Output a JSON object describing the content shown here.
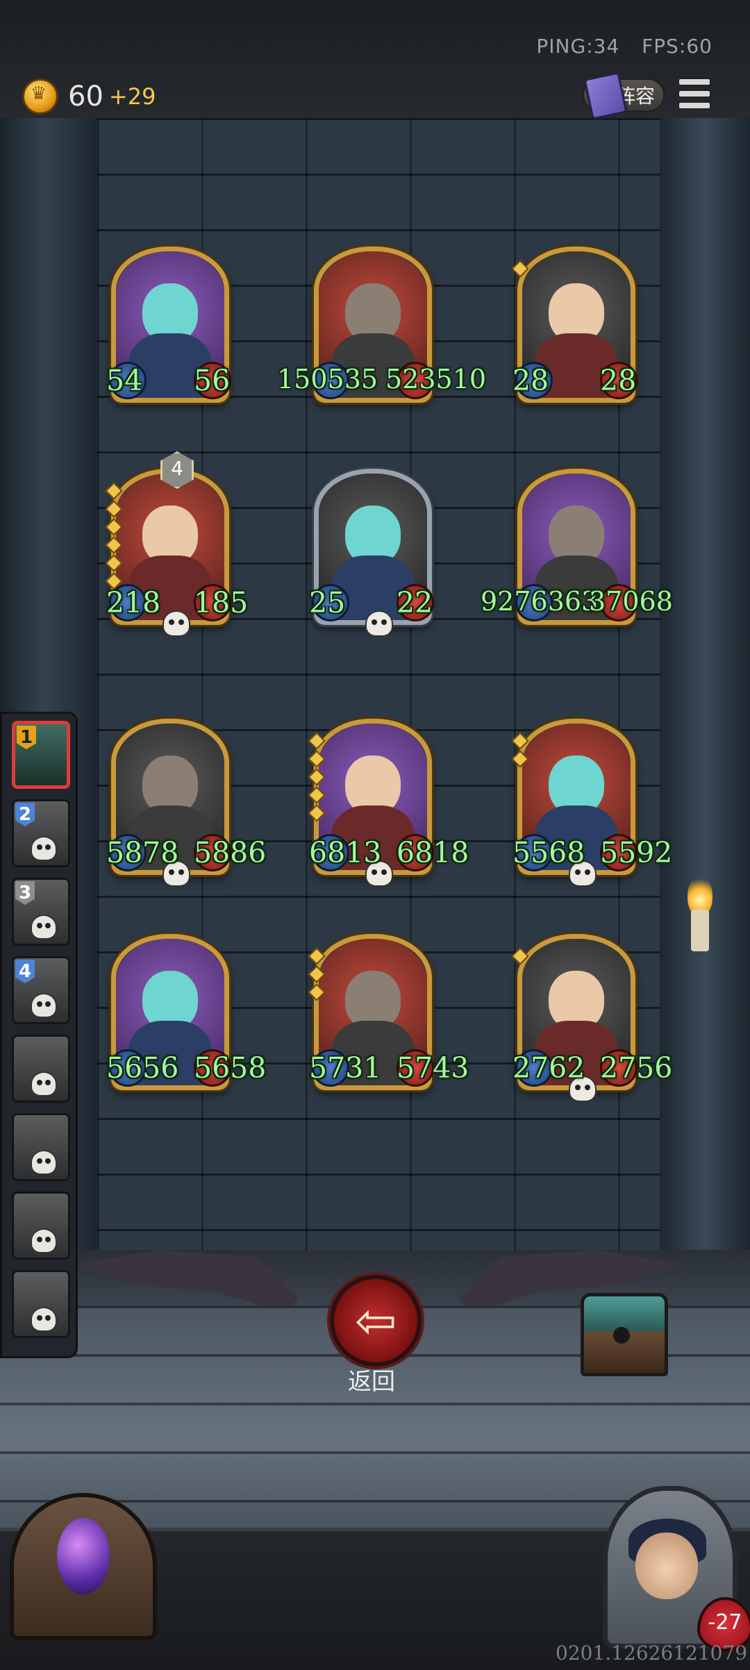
{
  "hud": {
    "ping": "PING:34",
    "fps": "FPS:60",
    "gold": "60",
    "gold_bonus": "+29",
    "lineup_label": "阵容"
  },
  "roster": [
    {
      "num": "1",
      "style": "gold",
      "active": true
    },
    {
      "num": "2",
      "style": "blue",
      "active": false
    },
    {
      "num": "3",
      "style": "gray",
      "active": false
    },
    {
      "num": "4",
      "style": "blue",
      "active": false
    },
    {
      "num": "",
      "style": "",
      "active": false
    },
    {
      "num": "",
      "style": "",
      "active": false
    },
    {
      "num": "",
      "style": "",
      "active": false
    },
    {
      "num": "",
      "style": "",
      "active": false
    }
  ],
  "board": {
    "row1": [
      {
        "atk": "54",
        "hp": "56"
      },
      {
        "atk": "150535",
        "hp": "523510"
      },
      {
        "atk": "28",
        "hp": "28"
      }
    ],
    "row2": [
      {
        "atk": "218",
        "hp": "185",
        "tier": "4"
      },
      {
        "atk": "25",
        "hp": "22"
      },
      {
        "atk": "9276363",
        "hp": "37068"
      }
    ],
    "row3": [
      {
        "atk": "5878",
        "hp": "5886"
      },
      {
        "atk": "6813",
        "hp": "6818"
      },
      {
        "atk": "5568",
        "hp": "5592"
      }
    ],
    "row4": [
      {
        "atk": "5656",
        "hp": "5658"
      },
      {
        "atk": "5731",
        "hp": "5743"
      },
      {
        "atk": "2762",
        "hp": "2756"
      }
    ]
  },
  "back_label": "返回",
  "hero_hp": "-27",
  "build_id": "0201.12626121079"
}
